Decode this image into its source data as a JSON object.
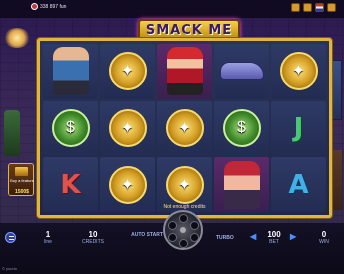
{
  "top": {
    "balance": "338 897 fun"
  },
  "logo": {
    "text": "SMACK ME"
  },
  "reels": [
    [
      "man",
      "gun",
      "money",
      "letter-k"
    ],
    [
      "gun",
      "gun",
      "gun",
      "gun"
    ],
    [
      "woman",
      "gun",
      "gun",
      "gun"
    ],
    [
      "car",
      "money",
      "letter-j",
      "woman2"
    ],
    [
      "gun",
      "letter-j",
      "letter-a",
      "letter-a"
    ]
  ],
  "feature_caption": "Not enough credits",
  "buy_feature": {
    "label": "Buy a feature",
    "price": "1500$"
  },
  "controls": {
    "line": {
      "value": "1",
      "label": "line"
    },
    "credits": {
      "value": "10",
      "label": "CREDITS"
    },
    "autostart": "AUTO START",
    "turbo": "TURBO",
    "bet": {
      "value": "100",
      "label": "BET"
    },
    "win": {
      "value": "0",
      "label": "WIN"
    }
  },
  "footer": "© yourlo"
}
